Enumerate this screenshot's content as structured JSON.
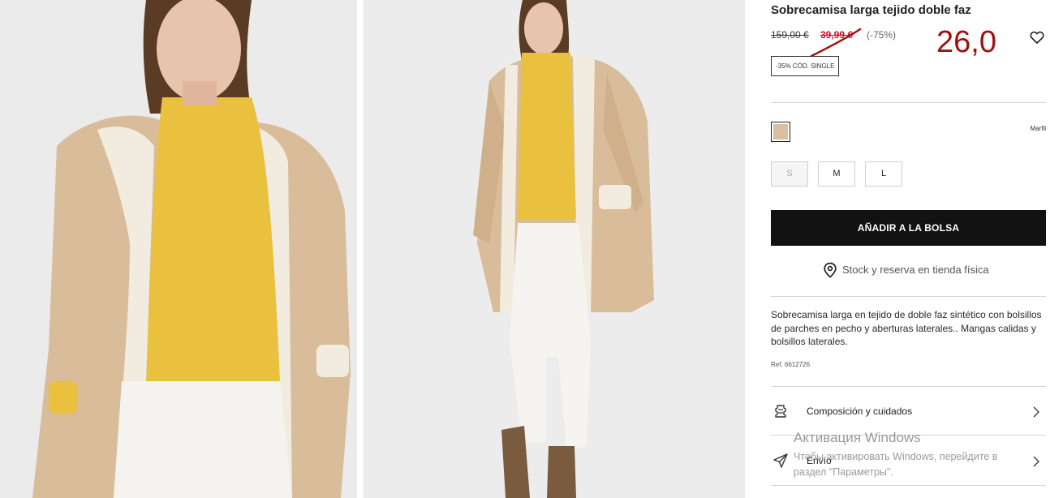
{
  "gallery": {
    "image_1_alt": "Sobrecamisa larga tejido doble faz - vista frontal",
    "image_2_alt": "Sobrecamisa larga tejido doble faz - cuerpo entero"
  },
  "product": {
    "title": "Sobrecamisa larga tejido doble faz",
    "original_price": "159,00 €",
    "sale_price": "39,99 €",
    "discount": "(-75%)",
    "handwritten_price": "26,0",
    "promo_code": "-35% CÓD. SINGLE",
    "color_name": "Marfil",
    "color_hex": "#d8c0a3",
    "sizes": [
      {
        "label": "S",
        "available": false
      },
      {
        "label": "M",
        "available": true
      },
      {
        "label": "L",
        "available": true
      }
    ],
    "add_to_bag": "AÑADIR A LA BOLSA",
    "stock_link": "Stock y reserva en tienda física",
    "description": "Sobrecamisa larga en tejido de doble faz sintético con bolsillos de parches en pecho y aberturas laterales.. Mangas calidas y bolsillos laterales.",
    "reference": "Ref. 6612726"
  },
  "accordion": [
    {
      "label": "Composición y cuidados",
      "icon": "care-label-icon"
    },
    {
      "label": "Envío",
      "icon": "paper-plane-icon"
    }
  ],
  "watermark": {
    "title": "Активация Windows",
    "subtitle_1": "Чтобы активировать Windows, перейдите в",
    "subtitle_2": "раздел \"Параметры\"."
  },
  "colors": {
    "sale_red": "#c8102e",
    "button_bg": "#121212",
    "annotation_red": "#a01010"
  }
}
